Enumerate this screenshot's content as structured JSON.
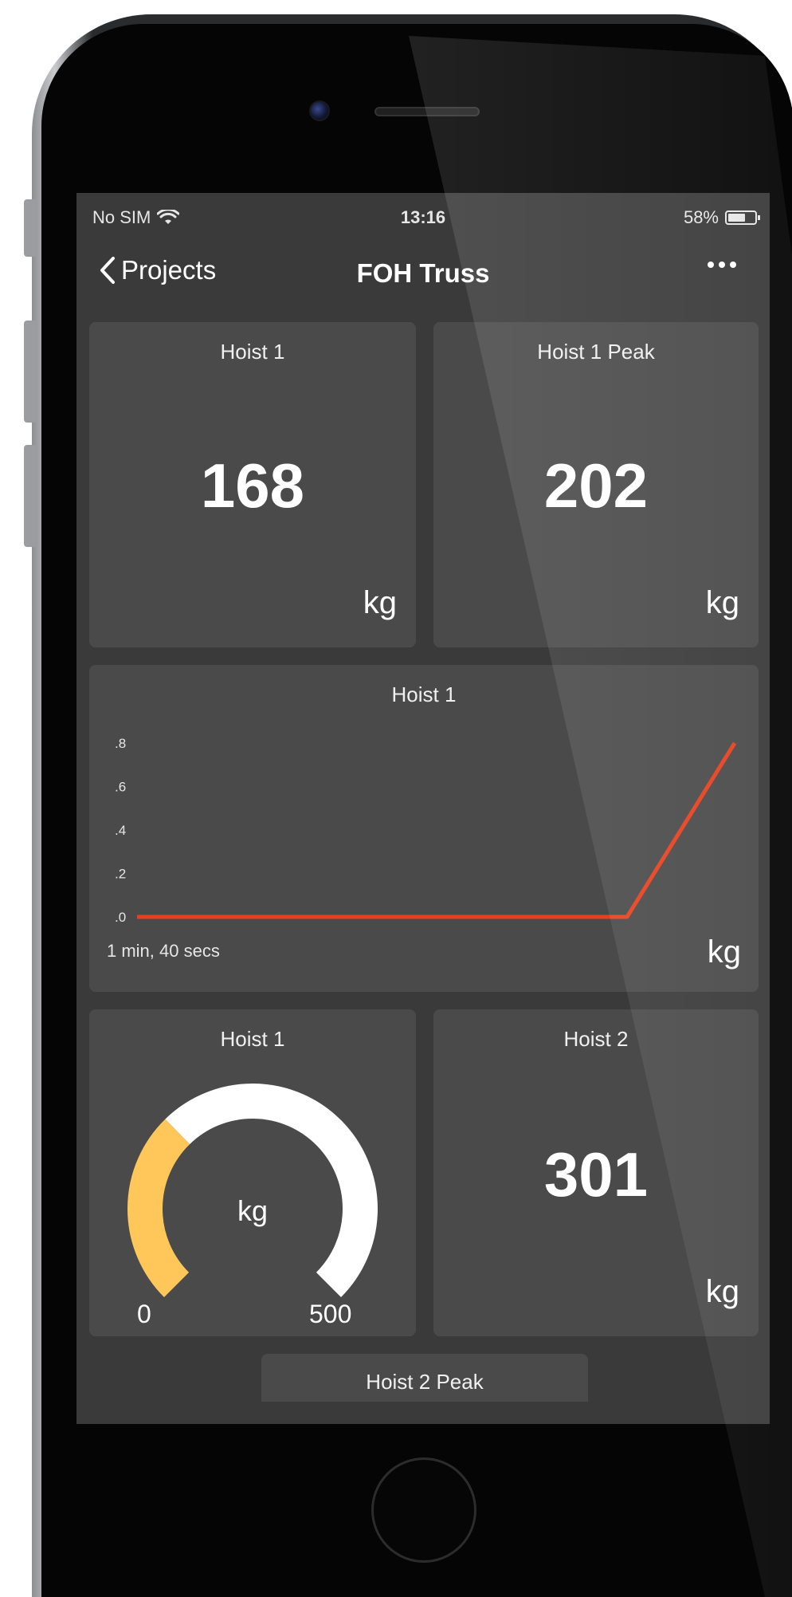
{
  "status_bar": {
    "carrier": "No SIM",
    "time": "13:16",
    "battery": "58%",
    "battery_level": 0.58
  },
  "nav": {
    "back_label": "Projects",
    "title": "FOH Truss",
    "more_icon": "ellipsis-icon"
  },
  "tiles": {
    "hoist1": {
      "title": "Hoist 1",
      "value": "168",
      "unit": "kg"
    },
    "hoist1_peak": {
      "title": "Hoist 1 Peak",
      "value": "202",
      "unit": "kg"
    },
    "hoist1_chart": {
      "title": "Hoist 1",
      "unit": "kg",
      "duration": "1 min, 40 secs"
    },
    "hoist1_gauge": {
      "title": "Hoist 1",
      "unit": "kg",
      "min": "0",
      "max": "500",
      "level": 0.336
    },
    "hoist2": {
      "title": "Hoist 2",
      "value": "301",
      "unit": "kg"
    },
    "hoist2_peak": {
      "title": "Hoist 2 Peak"
    }
  },
  "colors": {
    "screen_bg": "#3a3a3a",
    "tile_bg": "#4a4a4a",
    "line": "#e8401c",
    "gauge_fill": "#ffc65a",
    "gauge_track": "#ffffff"
  },
  "chart_data": {
    "type": "line",
    "title": "Hoist 1",
    "xlabel": "1 min, 40 secs",
    "ylabel": "kg",
    "y_ticks": [
      ".8",
      ".6",
      ".4",
      ".2",
      ".0"
    ],
    "ylim": [
      0,
      0.8
    ],
    "xlim": [
      0,
      100
    ],
    "series": [
      {
        "x": [
          0,
          10,
          20,
          30,
          40,
          50,
          60,
          70,
          82,
          100
        ],
        "y": [
          0,
          0,
          0,
          0,
          0,
          0,
          0,
          0,
          0,
          0.8
        ]
      }
    ]
  }
}
